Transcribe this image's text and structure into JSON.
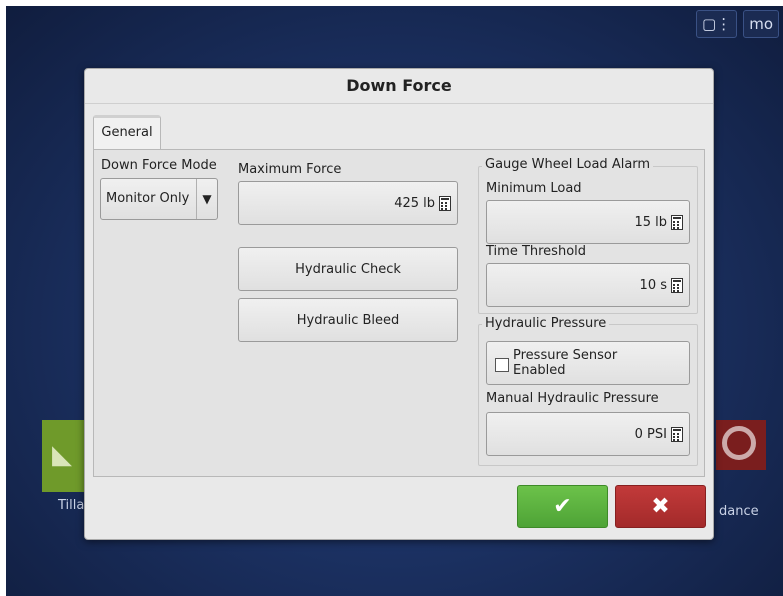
{
  "dialog": {
    "title": "Down Force",
    "tab_general": "General"
  },
  "down_force_mode": {
    "label": "Down Force Mode",
    "value": "Monitor Only",
    "arrow": "▼"
  },
  "maximum_force": {
    "label": "Maximum Force",
    "value": "425 lb"
  },
  "buttons": {
    "hydraulic_check": "Hydraulic Check",
    "hydraulic_bleed": "Hydraulic Bleed",
    "ok_glyph": "✔",
    "cancel_glyph": "✖"
  },
  "gauge_wheel_alarm": {
    "title": "Gauge Wheel Load Alarm",
    "min_load_label": "Minimum Load",
    "min_load_value": "15 lb",
    "time_threshold_label": "Time Threshold",
    "time_threshold_value": "10 s"
  },
  "hydraulic_pressure": {
    "title": "Hydraulic Pressure",
    "sensor_enabled_label": "Pressure Sensor Enabled",
    "sensor_enabled_checked": false,
    "manual_label": "Manual Hydraulic Pressure",
    "manual_value": "0 PSI"
  },
  "background": {
    "left_tile_label": "Tilla",
    "right_tile_label": "dance",
    "status_icon_1": "▢⋮",
    "status_icon_2": "mo"
  },
  "colors": {
    "ok": "#5cb23e",
    "cancel": "#b03030",
    "background": "#1c3264"
  }
}
